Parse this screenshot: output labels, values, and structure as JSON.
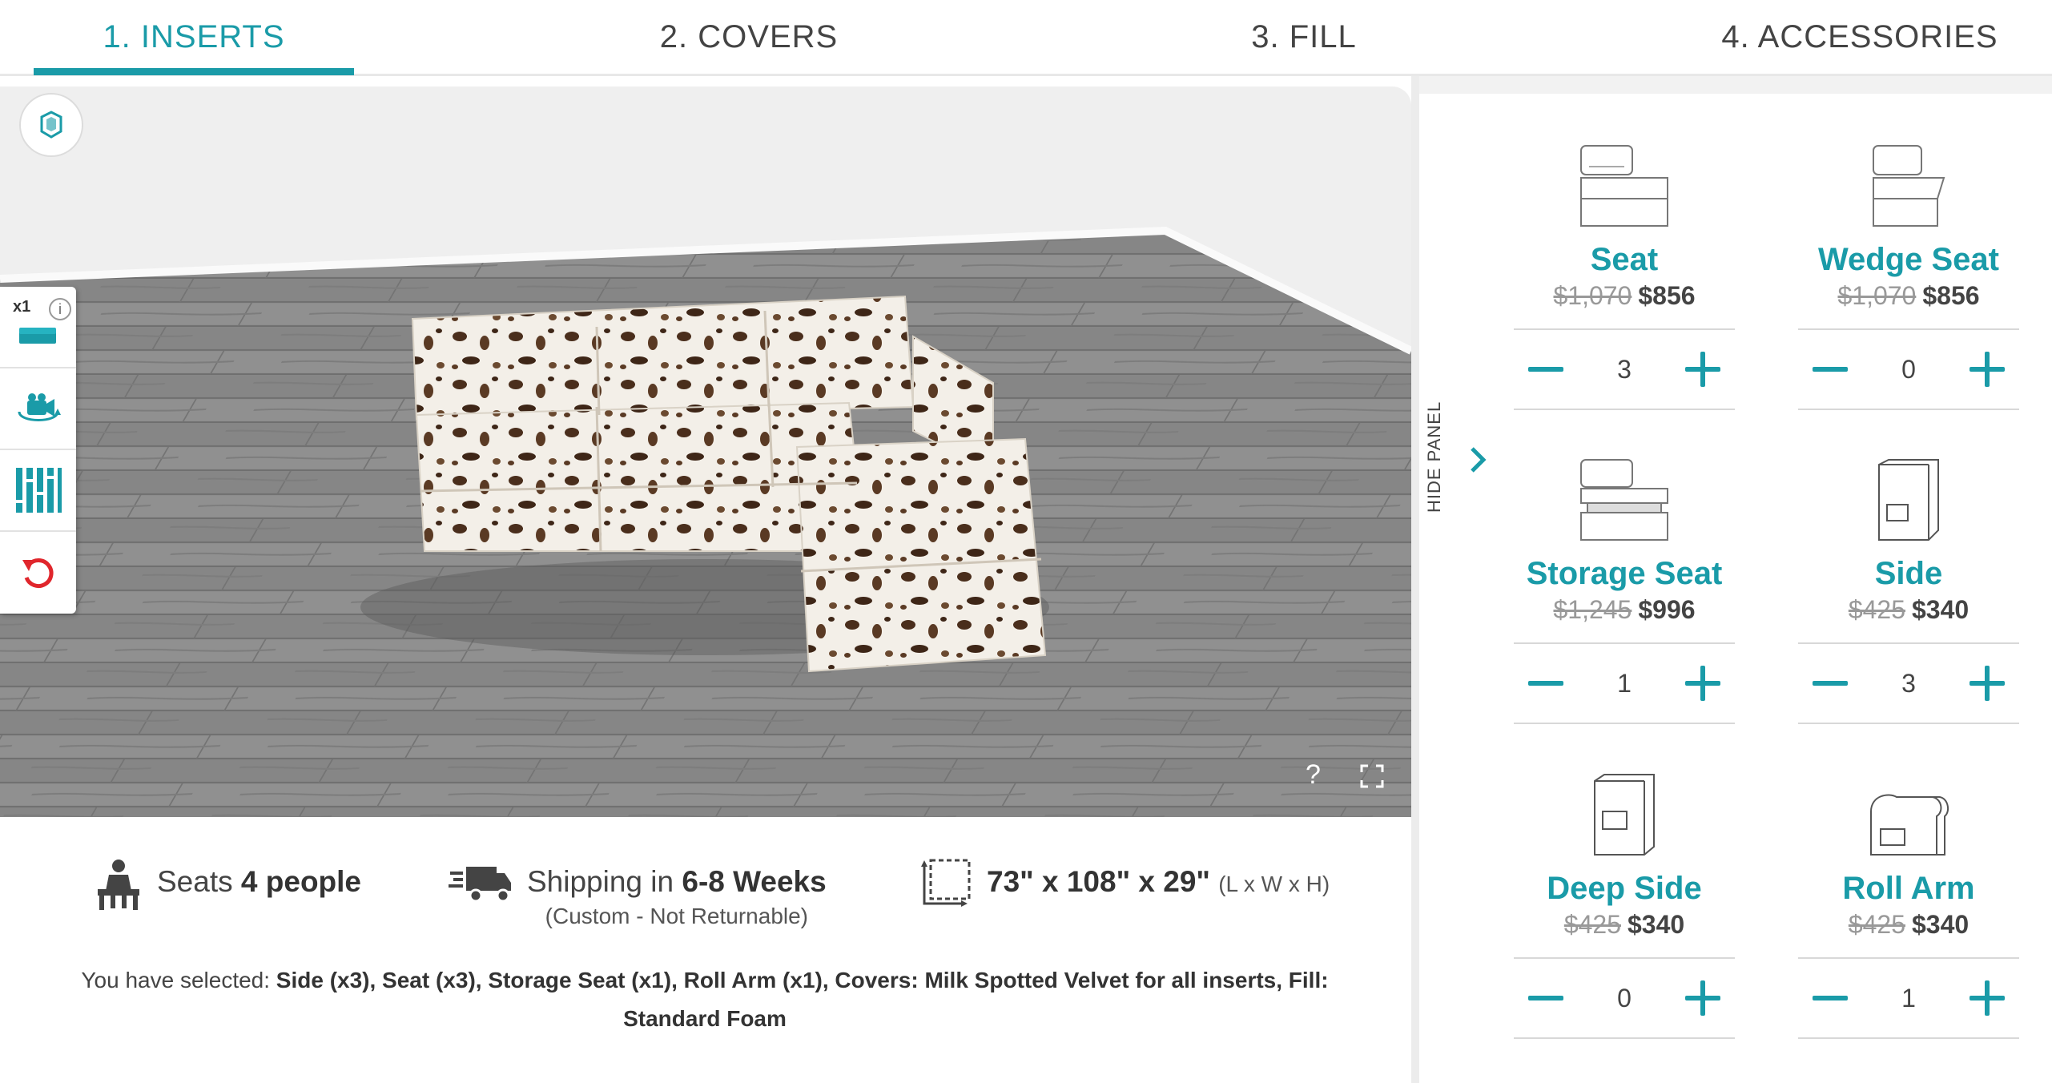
{
  "tabs": [
    {
      "label": "1. INSERTS",
      "active": true
    },
    {
      "label": "2. COVERS",
      "active": false
    },
    {
      "label": "3. FILL",
      "active": false
    },
    {
      "label": "4. ACCESSORIES",
      "active": false
    }
  ],
  "viewer": {
    "toolbar": {
      "quantity_badge": "x1",
      "info_glyph": "i",
      "tools": [
        "sofa-quantity-icon",
        "camera-rotate-icon",
        "layout-grid-icon",
        "reset-icon"
      ]
    },
    "help_glyph": "?",
    "fullscreen_icon": "fullscreen-icon"
  },
  "info": {
    "seats_prefix": "Seats",
    "seats_value": "4 people",
    "shipping_prefix": "Shipping in",
    "shipping_value": "6-8 Weeks",
    "shipping_note": "(Custom - Not Returnable)",
    "dimensions": "73\" x 108\" x 29\"",
    "dimensions_suffix": "(L x W x H)",
    "selected_prefix": "You have selected:",
    "selected_items": "Side (x3), Seat (x3), Storage Seat (x1), Roll Arm (x1), Covers: Milk Spotted Velvet for all inserts, Fill: Standard Foam"
  },
  "panel": {
    "hide_label": "HIDE PANEL",
    "products": [
      {
        "name": "Seat",
        "old_price": "$1,070",
        "price": "$856",
        "qty": "3",
        "icon": "seat-icon"
      },
      {
        "name": "Wedge Seat",
        "old_price": "$1,070",
        "price": "$856",
        "qty": "0",
        "icon": "wedge-seat-icon"
      },
      {
        "name": "Storage Seat",
        "old_price": "$1,245",
        "price": "$996",
        "qty": "1",
        "icon": "storage-seat-icon"
      },
      {
        "name": "Side",
        "old_price": "$425",
        "price": "$340",
        "qty": "3",
        "icon": "side-icon"
      },
      {
        "name": "Deep Side",
        "old_price": "$425",
        "price": "$340",
        "qty": "0",
        "icon": "deep-side-icon"
      },
      {
        "name": "Roll Arm",
        "old_price": "$425",
        "price": "$340",
        "qty": "1",
        "icon": "roll-arm-icon"
      }
    ]
  },
  "colors": {
    "accent": "#1a9ba8",
    "reset": "#e0262c"
  }
}
